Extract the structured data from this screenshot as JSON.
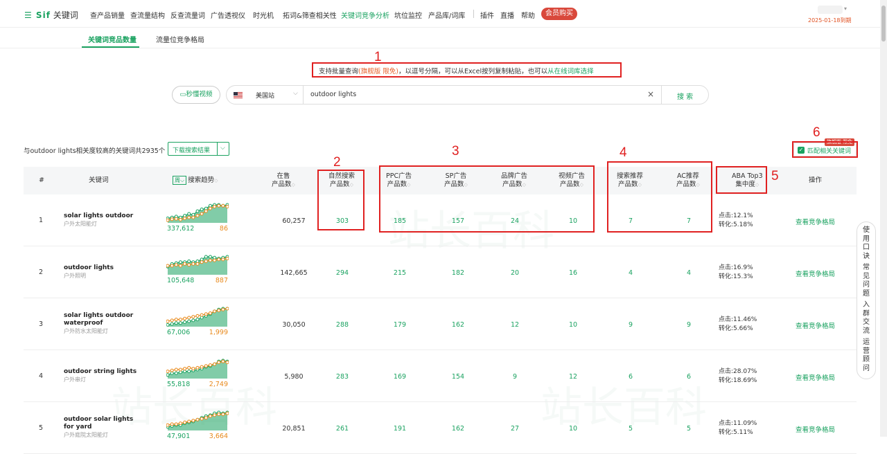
{
  "header": {
    "logo_mark": "☰ Sif",
    "logo_text": "关键词",
    "nav": [
      "查产品销量",
      "查流量结构",
      "反查流量词",
      "广告透视仪",
      "时光机",
      "拓词&筛查相关性",
      "关键词竞争分析",
      "坑位监控",
      "产品库/词库",
      "插件",
      "直播",
      "帮助"
    ],
    "active_nav": "关键词竞争分析",
    "vip_button": "会员购买",
    "expire": "2025-01-18到期"
  },
  "subnav": {
    "tabs": [
      "关键词竞品数量",
      "流量位竞争格局"
    ],
    "active": "关键词竞品数量"
  },
  "hint": {
    "prefix": "支持批量查询",
    "highlight": "(旗舰版 限免)",
    "middle": "，以逗号分隔，可以从Excel按列复制粘贴，也可以",
    "link": "从在线词库选择"
  },
  "search": {
    "video_button": "秒懂视频",
    "site": "美国站",
    "query": "outdoor lights",
    "clear_icon": "×",
    "search_button": "搜 索"
  },
  "results": {
    "count_text": "与outdoor lights相关度较高的关键词共2935个",
    "download_button": "下载搜索结果",
    "match_checkbox": "匹配相关关键词",
    "match_badge": "旗舰版·限免"
  },
  "annotations": [
    "1",
    "2",
    "3",
    "4",
    "5",
    "6"
  ],
  "columns": {
    "index": "#",
    "keyword": "关键词",
    "period": "周",
    "trend": "搜索趋势",
    "on_sale_1": "在售",
    "on_sale_2": "产品数",
    "organic_1": "自然搜索",
    "organic_2": "产品数",
    "ppc_1": "PPC广告",
    "ppc_2": "产品数",
    "sp_1": "SP广告",
    "sp_2": "产品数",
    "brand_1": "品牌广告",
    "brand_2": "产品数",
    "video_1": "视频广告",
    "video_2": "产品数",
    "rec_1": "搜索推荐",
    "rec_2": "产品数",
    "ac_1": "AC推荐",
    "ac_2": "产品数",
    "aba_1": "ABA Top3",
    "aba_2": "集中度",
    "action": "操作"
  },
  "rows": [
    {
      "index": "1",
      "keyword": "solar lights outdoor",
      "keyword_cn": "户外太阳能灯",
      "search_volume": "337,612",
      "rank": "86",
      "on_sale": "60,257",
      "organic": "303",
      "ppc": "185",
      "sp": "157",
      "brand": "24",
      "video": "10",
      "rec": "7",
      "ac": "7",
      "click": "点击:12.1%",
      "conv": "转化:5.18%",
      "action": "查看竞争格局",
      "trend": {
        "search": [
          0.25,
          0.3,
          0.35,
          0.3,
          0.4,
          0.5,
          0.45,
          0.65,
          0.75,
          0.8,
          0.95,
          1,
          1,
          0.95,
          1
        ],
        "rank": [
          0.15,
          0.2,
          0.22,
          0.18,
          0.25,
          0.3,
          0.3,
          0.4,
          0.5,
          0.65,
          0.8,
          0.9,
          0.95,
          0.95,
          0.9
        ]
      }
    },
    {
      "index": "2",
      "keyword": "outdoor lights",
      "keyword_cn": "户外照明",
      "search_volume": "105,648",
      "rank": "887",
      "on_sale": "142,665",
      "organic": "294",
      "ppc": "215",
      "sp": "182",
      "brand": "20",
      "video": "16",
      "rec": "4",
      "ac": "4",
      "click": "点击:16.9%",
      "conv": "转化:15.3%",
      "action": "查看竞争格局",
      "trend": {
        "search": [
          0.45,
          0.6,
          0.65,
          0.7,
          0.7,
          0.75,
          0.7,
          0.75,
          0.85,
          1,
          1,
          0.95,
          0.9,
          0.95,
          1
        ],
        "rank": [
          0.5,
          0.5,
          0.55,
          0.5,
          0.6,
          0.55,
          0.6,
          0.6,
          0.7,
          0.75,
          0.8,
          0.8,
          0.85,
          0.85,
          0.9
        ]
      }
    },
    {
      "index": "3",
      "keyword": "solar lights outdoor waterproof",
      "keyword_cn": "户外防水太阳能灯",
      "search_volume": "67,006",
      "rank": "1,999",
      "on_sale": "30,050",
      "organic": "288",
      "ppc": "179",
      "sp": "162",
      "brand": "12",
      "video": "10",
      "rec": "9",
      "ac": "9",
      "click": "点击:11.46%",
      "conv": "转化:5.66%",
      "action": "查看竞争格局",
      "trend": {
        "search": [
          0.1,
          0.15,
          0.2,
          0.2,
          0.25,
          0.3,
          0.35,
          0.4,
          0.5,
          0.6,
          0.7,
          0.85,
          0.95,
          1,
          1
        ],
        "rank": [
          0.3,
          0.35,
          0.4,
          0.4,
          0.45,
          0.5,
          0.55,
          0.6,
          0.65,
          0.7,
          0.75,
          0.85,
          0.9,
          0.95,
          1
        ]
      }
    },
    {
      "index": "4",
      "keyword": "outdoor string lights",
      "keyword_cn": "户外串灯",
      "search_volume": "55,818",
      "rank": "2,749",
      "on_sale": "5,980",
      "organic": "283",
      "ppc": "169",
      "sp": "154",
      "brand": "9",
      "video": "12",
      "rec": "6",
      "ac": "6",
      "click": "点击:28.07%",
      "conv": "转化:18.69%",
      "action": "查看竞争格局",
      "trend": {
        "search": [
          0.2,
          0.3,
          0.3,
          0.35,
          0.4,
          0.4,
          0.45,
          0.5,
          0.55,
          0.65,
          0.7,
          0.8,
          0.95,
          1,
          0.95
        ],
        "rank": [
          0.4,
          0.45,
          0.5,
          0.5,
          0.55,
          0.6,
          0.55,
          0.6,
          0.65,
          0.7,
          0.75,
          0.8,
          0.9,
          0.95,
          0.9
        ]
      }
    },
    {
      "index": "5",
      "keyword": "outdoor solar lights for yard",
      "keyword_cn": "户外庭院太阳能灯",
      "search_volume": "47,901",
      "rank": "3,664",
      "on_sale": "20,851",
      "organic": "261",
      "ppc": "191",
      "sp": "162",
      "brand": "27",
      "video": "10",
      "rec": "5",
      "ac": "5",
      "click": "点击:11.09%",
      "conv": "转化:5.11%",
      "action": "查看竞争格局",
      "trend": {
        "search": [
          0.2,
          0.25,
          0.3,
          0.3,
          0.4,
          0.45,
          0.5,
          0.6,
          0.7,
          0.8,
          0.85,
          0.95,
          1,
          0.95,
          1
        ],
        "rank": [
          0.3,
          0.35,
          0.35,
          0.4,
          0.45,
          0.5,
          0.55,
          0.6,
          0.65,
          0.7,
          0.8,
          0.85,
          0.9,
          0.9,
          0.95
        ]
      }
    }
  ],
  "sidebar": [
    "使",
    "用",
    "口",
    "诀",
    "常",
    "见",
    "问",
    "题",
    "入",
    "群",
    "交",
    "流",
    "运",
    "营",
    "顾",
    "问"
  ],
  "colors": {
    "accent": "#1aa260",
    "annotation": "#e02020",
    "rank": "#e8891b",
    "vip": "#d9483b"
  }
}
